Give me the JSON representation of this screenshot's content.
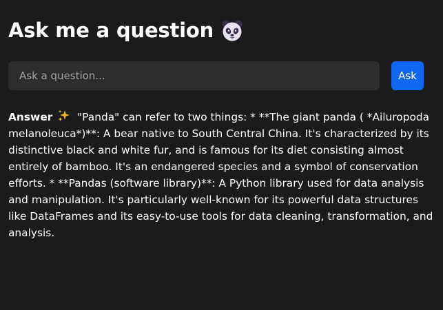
{
  "header": {
    "title": "Ask me a question",
    "title_icon": "panda-face-icon"
  },
  "search": {
    "placeholder": "Ask a question...",
    "value": "",
    "button_label": "Ask"
  },
  "answer": {
    "label": "Answer",
    "label_icon": "sparkles-icon",
    "text": "\"Panda\" can refer to two things: * **The giant panda ( *Ailuropoda melanoleuca*)**: A bear native to South Central China. It's characterized by its distinctive black and white fur, and is famous for its diet consisting almost entirely of bamboo. It's an endangered species and a symbol of conservation efforts. * **Pandas (software library)**: A Python library used for data analysis and manipulation. It's particularly well-known for its powerful data structures like DataFrames and its easy-to-use tools for data cleaning, transformation, and analysis."
  },
  "colors": {
    "background": "#1b1b1b",
    "input_background": "#2d2d2d",
    "accent": "#1167f2",
    "text": "#ffffff",
    "placeholder": "#a3a3a3",
    "sparkle": "#f7b733"
  }
}
